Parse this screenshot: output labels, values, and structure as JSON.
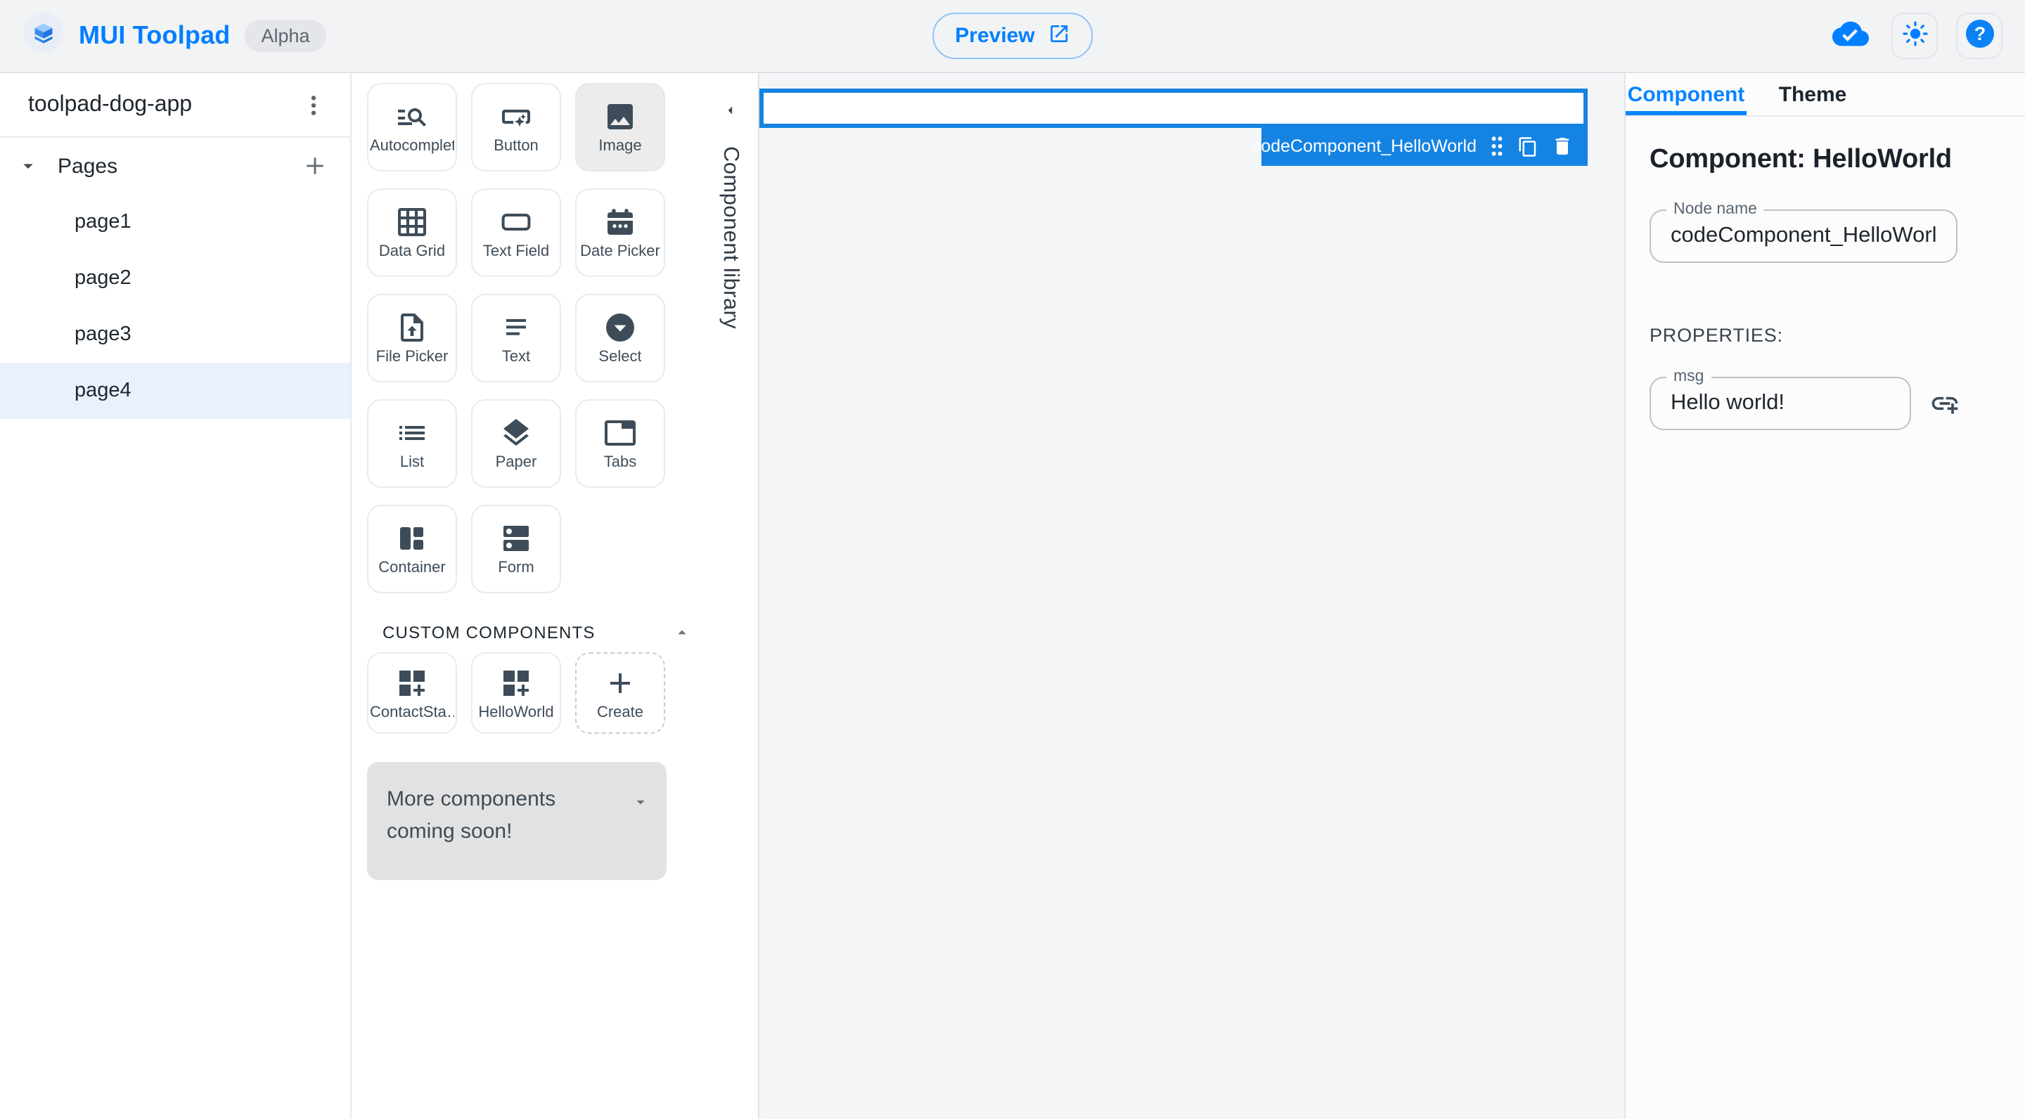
{
  "header": {
    "app_title": "MUI Toolpad",
    "badge": "Alpha",
    "preview_label": "Preview"
  },
  "sidebar": {
    "app_name": "toolpad-dog-app",
    "pages_label": "Pages",
    "pages": [
      {
        "name": "page1",
        "selected": false
      },
      {
        "name": "page2",
        "selected": false
      },
      {
        "name": "page3",
        "selected": false
      },
      {
        "name": "page4",
        "selected": true
      }
    ]
  },
  "library": {
    "drawer_label": "Component library",
    "components": [
      {
        "label": "Autocomplete",
        "icon": "autocomplete",
        "selected": false
      },
      {
        "label": "Button",
        "icon": "button",
        "selected": false
      },
      {
        "label": "Image",
        "icon": "image",
        "selected": true
      },
      {
        "label": "Data Grid",
        "icon": "datagrid",
        "selected": false
      },
      {
        "label": "Text Field",
        "icon": "textfield",
        "selected": false
      },
      {
        "label": "Date Picker",
        "icon": "datepicker",
        "selected": false
      },
      {
        "label": "File Picker",
        "icon": "filepicker",
        "selected": false
      },
      {
        "label": "Text",
        "icon": "text",
        "selected": false
      },
      {
        "label": "Select",
        "icon": "select",
        "selected": false
      },
      {
        "label": "List",
        "icon": "list",
        "selected": false
      },
      {
        "label": "Paper",
        "icon": "paper",
        "selected": false
      },
      {
        "label": "Tabs",
        "icon": "tabs",
        "selected": false
      },
      {
        "label": "Container",
        "icon": "container",
        "selected": false
      },
      {
        "label": "Form",
        "icon": "form",
        "selected": false
      }
    ],
    "custom_section_label": "CUSTOM COMPONENTS",
    "custom_components": [
      {
        "label": "ContactSta…",
        "icon": "custom",
        "create": false
      },
      {
        "label": "HelloWorld",
        "icon": "custom",
        "create": false
      },
      {
        "label": "Create",
        "icon": "plus",
        "create": true
      }
    ],
    "banner_text": "More components coming soon!"
  },
  "canvas": {
    "selection_label": "codeComponent_HelloWorld"
  },
  "inspector": {
    "tabs": [
      {
        "label": "Component",
        "active": true
      },
      {
        "label": "Theme",
        "active": false
      }
    ],
    "heading": "Component: HelloWorld",
    "node_name_label": "Node name",
    "node_name_value": "codeComponent_HelloWorld",
    "properties_label": "PROPERTIES:",
    "msg_label": "msg",
    "msg_value": "Hello world!"
  },
  "colors": {
    "accent": "#007fff",
    "selection": "#1583e2",
    "header-bg": "#f2f3f5",
    "canvas-bg": "#f4f5f6",
    "panel-bg": "#fcfcfd",
    "selected-row": "#e9f2fc",
    "icon-slate": "#3e4c59"
  }
}
